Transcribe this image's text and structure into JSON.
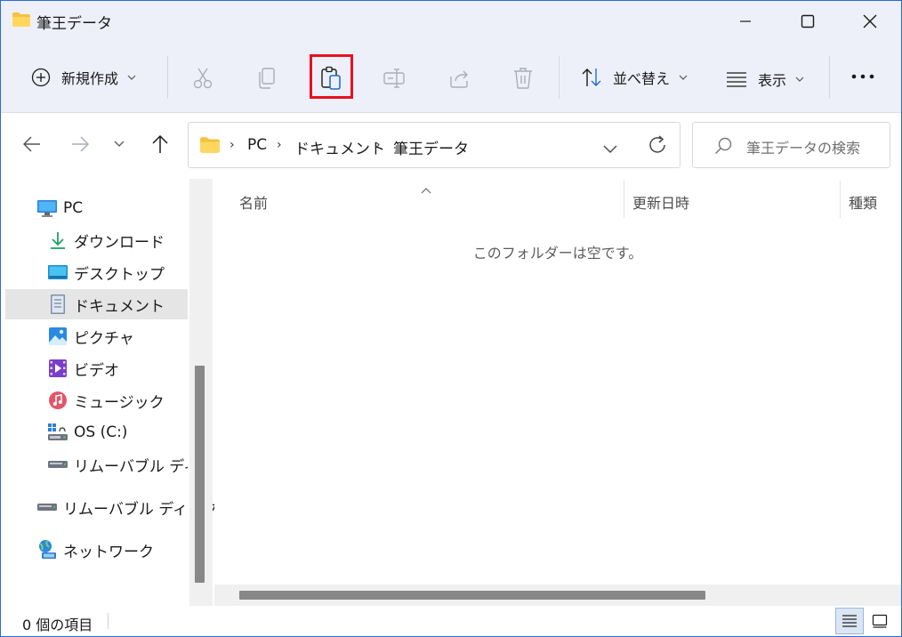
{
  "window": {
    "title": "筆王データ"
  },
  "commandbar": {
    "new_label": "新規作成",
    "sort_label": "並べ替え",
    "view_label": "表示"
  },
  "address": {
    "crumbs": [
      "PC",
      "ドキュメント",
      "筆王データ"
    ]
  },
  "search": {
    "placeholder": "筆王データの検索"
  },
  "sidebar": {
    "items": [
      {
        "label": "PC",
        "icon": "pc-icon"
      },
      {
        "label": "ダウンロード",
        "icon": "download-icon"
      },
      {
        "label": "デスクトップ",
        "icon": "desktop-icon"
      },
      {
        "label": "ドキュメント",
        "icon": "documents-icon",
        "selected": true
      },
      {
        "label": "ピクチャ",
        "icon": "pictures-icon"
      },
      {
        "label": "ビデオ",
        "icon": "videos-icon"
      },
      {
        "label": "ミュージック",
        "icon": "music-icon"
      },
      {
        "label": "OS (C:)",
        "icon": "drive-icon"
      },
      {
        "label": "リムーバブル ディスク",
        "icon": "removable-disk-icon"
      },
      {
        "label": "リムーバブル ディスク",
        "icon": "removable-disk-icon"
      },
      {
        "label": "ネットワーク",
        "icon": "network-icon"
      }
    ]
  },
  "content": {
    "columns": [
      "名前",
      "更新日時",
      "種類"
    ],
    "empty_message": "このフォルダーは空です。"
  },
  "statusbar": {
    "item_count": "0 個の項目"
  },
  "colors": {
    "accent": "#2a6cd6",
    "highlight_box": "#e8101f",
    "toolbar_bg": "#eef0f9",
    "folder_yellow": "#f4c242"
  }
}
